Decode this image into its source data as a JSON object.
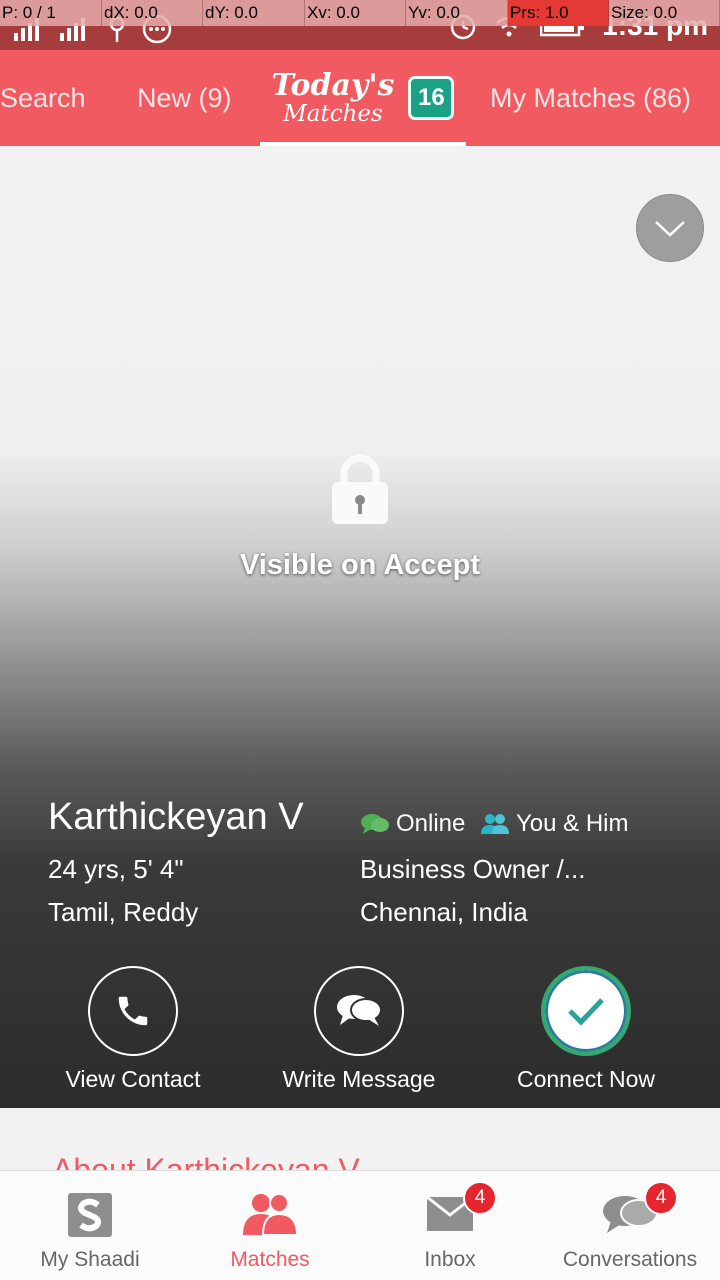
{
  "debug": {
    "cells": [
      "P: 0 / 1",
      "dX: 0.0",
      "dY: 0.0",
      "Xv: 0.0",
      "Yv: 0.0",
      "Prs: 1.0",
      "Size: 0.0"
    ]
  },
  "status": {
    "time": "1:31 pm"
  },
  "tabs": {
    "search": "Search",
    "new": "New (9)",
    "today_line1": "Today's",
    "today_line2": "Matches",
    "today_badge": "16",
    "my_matches": "My Matches (86)"
  },
  "profile": {
    "lock_text": "Visible on Accept",
    "name": "Karthickeyan V",
    "age_height": "24 yrs, 5' 4\"",
    "community": "Tamil, Reddy",
    "online": "Online",
    "relation": "You & Him",
    "profession": "Business Owner /...",
    "location": "Chennai, India"
  },
  "actions": {
    "view_contact": "View Contact",
    "write_message": "Write Message",
    "connect_now": "Connect Now"
  },
  "about": {
    "title": "About Karthickeyan V"
  },
  "nav": {
    "my_shaadi": "My Shaadi",
    "matches": "Matches",
    "inbox": "Inbox",
    "inbox_badge": "4",
    "conversations": "Conversations",
    "conversations_badge": "4"
  },
  "colors": {
    "brand": "#f05a60",
    "status_bar": "#a73c3c",
    "badge_green": "#1aa287",
    "online_green": "#4caf50",
    "badge_red": "#e6262f"
  }
}
